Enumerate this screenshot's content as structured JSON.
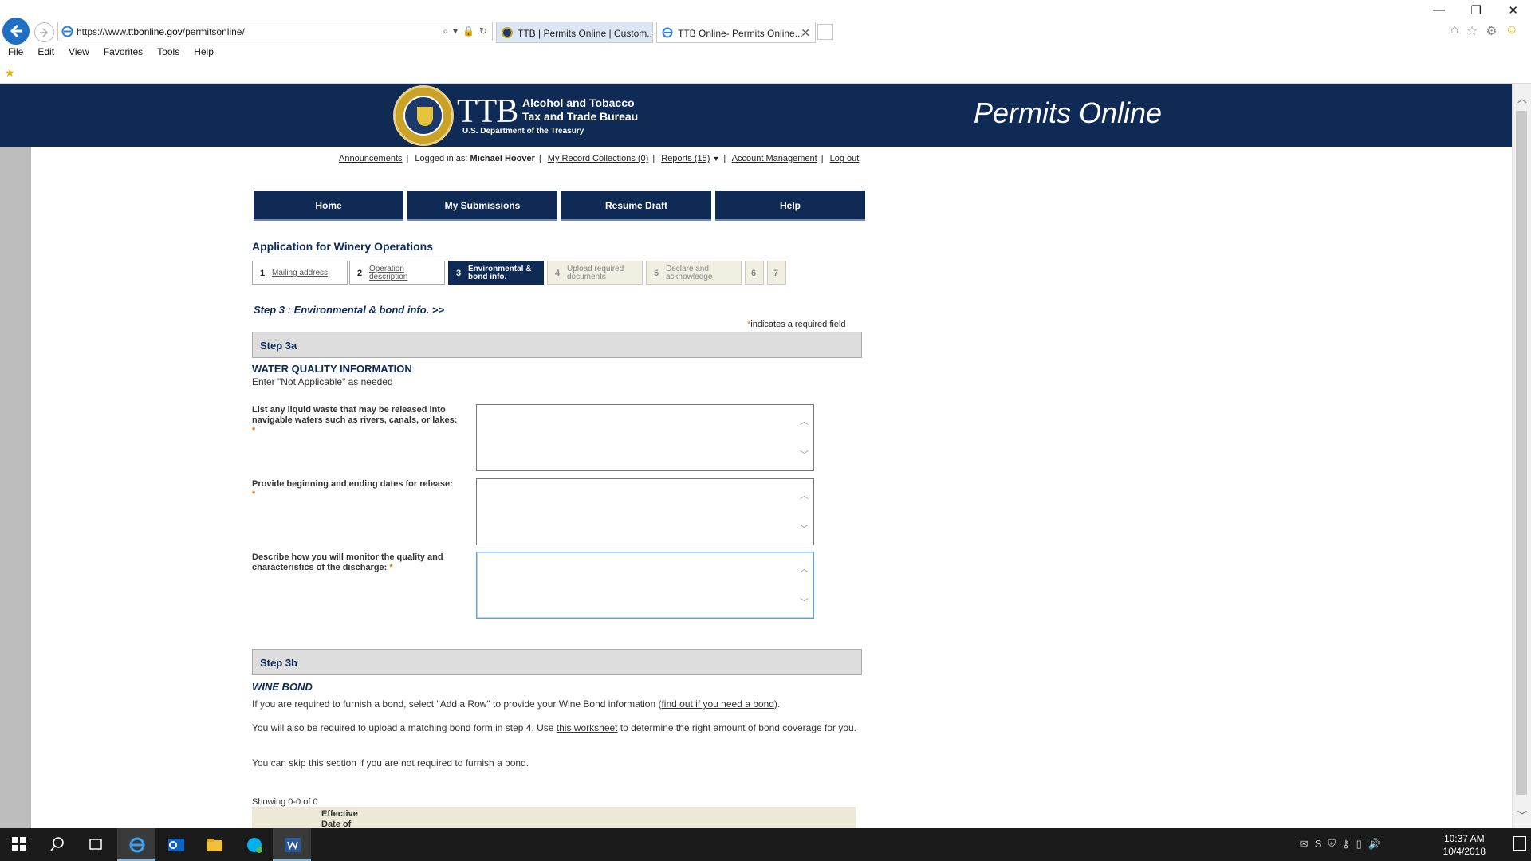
{
  "browser": {
    "url_prefix": "https://www.",
    "url_domain": "ttbonline.gov",
    "url_path": "/permitsonline/",
    "tabs": [
      {
        "label": "TTB | Permits Online | Custom..."
      },
      {
        "label": "TTB Online- Permits Online..."
      }
    ],
    "menu": [
      "File",
      "Edit",
      "View",
      "Favorites",
      "Tools",
      "Help"
    ],
    "window_controls": {
      "minimize": "—",
      "restore": "❐",
      "close": "✕"
    }
  },
  "banner": {
    "mark": "TTB",
    "name_line1": "Alcohol and Tobacco",
    "name_line2": "Tax and Trade Bureau",
    "department": "U.S. Department of the Treasury",
    "product": "Permits Online"
  },
  "toplinks": {
    "announcements": "Announcements",
    "logged_in_label": "Logged in as:",
    "user": "Michael Hoover",
    "record_collections": "My Record Collections (0)",
    "reports": "Reports (15)",
    "account": "Account Management",
    "logout": "Log out"
  },
  "nav": {
    "home": "Home",
    "submissions": "My Submissions",
    "resume": "Resume Draft",
    "help": "Help"
  },
  "app_title": "Application for Winery Operations",
  "steps": [
    {
      "num": "1",
      "label": "Mailing address"
    },
    {
      "num": "2",
      "label_l1": "Operation",
      "label_l2": "description"
    },
    {
      "num": "3",
      "label_l1": "Environmental &",
      "label_l2": "bond info."
    },
    {
      "num": "4",
      "label_l1": "Upload required",
      "label_l2": "documents"
    },
    {
      "num": "5",
      "label_l1": "Declare and",
      "label_l2": "acknowledge"
    },
    {
      "num": "6"
    },
    {
      "num": "7"
    }
  ],
  "step_heading": "Step 3 : Environmental & bond info. >>",
  "required_note": {
    "asterisk": "*",
    "text": "indicates a required field"
  },
  "step3a": {
    "title": "Step 3a",
    "subhead": "WATER QUALITY INFORMATION",
    "note": "Enter \"Not Applicable\" as needed",
    "fields": [
      {
        "label": "List any liquid waste that may be released into navigable waters such as rivers, canals, or lakes:",
        "value": ""
      },
      {
        "label": "Provide beginning and ending dates for release:",
        "value": ""
      },
      {
        "label": "Describe how you will monitor the quality and characteristics of the discharge:",
        "value": ""
      }
    ],
    "asterisk": "*"
  },
  "step3b": {
    "title": "Step 3b",
    "subhead": "WINE BOND",
    "p1_pre": "If you are required to furnish a bond, select \"Add a Row\" to provide your Wine Bond information (",
    "p1_link": "find out if you need a bond",
    "p1_post": ").",
    "p2_pre": "You will also be required to upload a matching bond form in step 4. Use ",
    "p2_link": "this worksheet",
    "p2_post": " to determine the right amount of bond coverage for you.",
    "p3": "You can skip this section if you are not required to furnish a bond.",
    "showing": "Showing 0-0 of 0",
    "col1_l1": "Effective",
    "col1_l2": "Date of"
  },
  "taskbar": {
    "time": "10:37 AM",
    "date": "10/4/2018"
  }
}
